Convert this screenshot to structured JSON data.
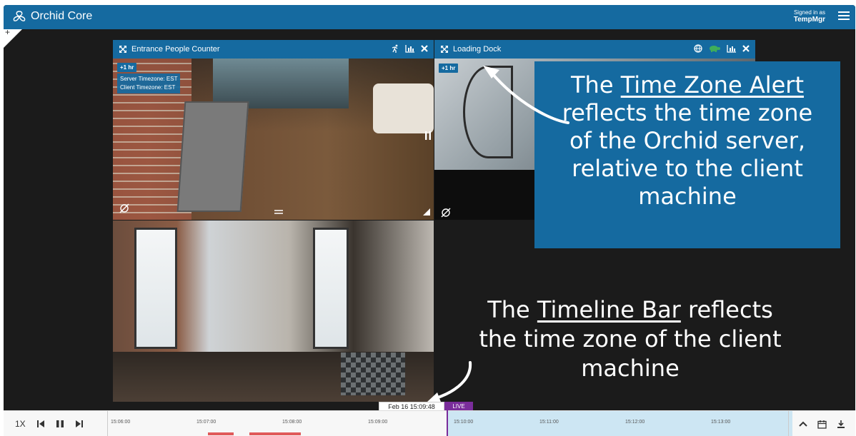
{
  "app": {
    "title": "Orchid Core"
  },
  "user": {
    "signed_in_label": "Signed in as",
    "username": "TempMgr"
  },
  "tiles": {
    "entrance": {
      "title": "Entrance People Counter",
      "tz_badge": "+1 hr",
      "server_tz": "Server Timezone: EST",
      "client_tz": "Client Timezone: EST"
    },
    "dock": {
      "title": "Loading Dock",
      "tz_badge": "+1 hr"
    }
  },
  "callouts": {
    "top": {
      "line1_prefix": "The ",
      "line1_link": "Time Zone Alert",
      "rest": "reflects the time zone of the Orchid server, relative to the client machine"
    },
    "bottom": {
      "line1_prefix": "The ",
      "line1_link": "Timeline Bar",
      "line1_suffix": " reflects",
      "rest": "the time zone of the client machine"
    }
  },
  "timeline": {
    "speed": "1X",
    "current_time": "Feb 16 15:09:48",
    "live_label": "LIVE",
    "ticks": [
      "15:06:00",
      "15:07:00",
      "15:08:00",
      "15:09:00",
      "15:10:00",
      "15:11:00",
      "15:12:00",
      "15:13:00"
    ]
  },
  "colors": {
    "brand": "#156aa0",
    "live": "#7a2d9b",
    "motion": "#e05a5a"
  }
}
